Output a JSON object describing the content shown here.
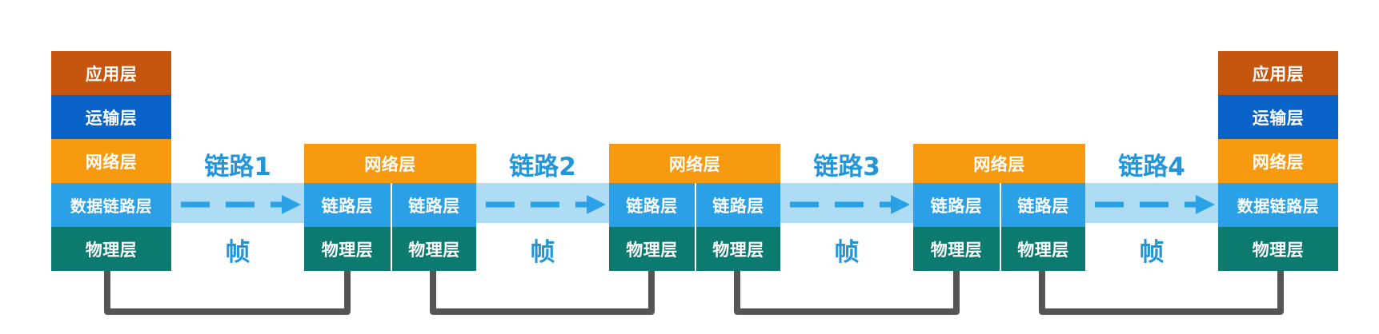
{
  "colors": {
    "application": "#c65510",
    "transport": "#0a63c9",
    "network": "#f79a10",
    "data_link": "#2aa0e6",
    "physical": "#0c7a6e",
    "band": "#aedcf4",
    "link_text": "#2296d8",
    "cable": "#555555"
  },
  "end_host_left": {
    "application": "应用层",
    "transport": "运输层",
    "network": "网络层",
    "data_link": "数据链路层",
    "physical": "物理层"
  },
  "end_host_right": {
    "application": "应用层",
    "transport": "运输层",
    "network": "网络层",
    "data_link": "数据链路层",
    "physical": "物理层"
  },
  "routers": [
    {
      "network": "网络层",
      "data_link_left": "链路层",
      "data_link_right": "链路层",
      "physical_left": "物理层",
      "physical_right": "物理层"
    },
    {
      "network": "网络层",
      "data_link_left": "链路层",
      "data_link_right": "链路层",
      "physical_left": "物理层",
      "physical_right": "物理层"
    },
    {
      "network": "网络层",
      "data_link_left": "链路层",
      "data_link_right": "链路层",
      "physical_left": "物理层",
      "physical_right": "物理层"
    }
  ],
  "links": [
    {
      "label": "链路1",
      "unit": "帧"
    },
    {
      "label": "链路2",
      "unit": "帧"
    },
    {
      "label": "链路3",
      "unit": "帧"
    },
    {
      "label": "链路4",
      "unit": "帧"
    }
  ]
}
